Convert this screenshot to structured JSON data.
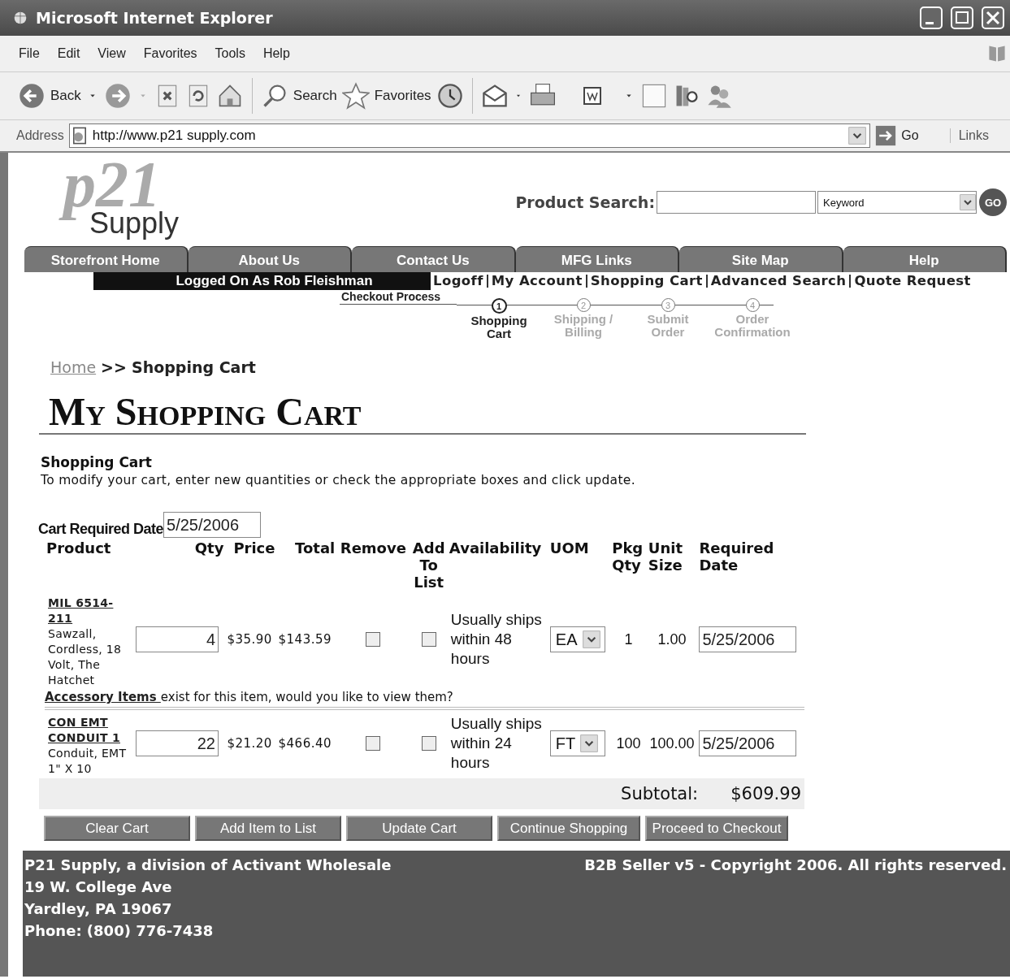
{
  "window": {
    "title": "Microsoft Internet Explorer"
  },
  "menu": [
    "File",
    "Edit",
    "View",
    "Favorites",
    "Tools",
    "Help"
  ],
  "toolbar": {
    "back": "Back",
    "search": "Search",
    "favorites": "Favorites"
  },
  "address": {
    "label": "Address",
    "url": "http://www.p21 supply.com",
    "go": "Go",
    "links": "Links"
  },
  "header": {
    "logo_mark": "p21",
    "logo_word": "Supply",
    "search_label": "Product Search:",
    "search_type": "Keyword",
    "go": "GO"
  },
  "nav_tabs": [
    "Storefront Home",
    "About Us",
    "Contact Us",
    "MFG Links",
    "Site Map",
    "Help"
  ],
  "logged_in": "Logged On As Rob Fleishman",
  "user_links": [
    "Logoff",
    "My Account",
    "Shopping Cart",
    "Advanced Search",
    "Quote Request"
  ],
  "checkout": {
    "label": "Checkout Process",
    "steps": [
      {
        "number": "1",
        "lines": [
          "Shopping",
          "Cart"
        ],
        "selected": true
      },
      {
        "number": "2",
        "lines": [
          "Shipping /",
          "Billing"
        ],
        "selected": false
      },
      {
        "number": "3",
        "lines": [
          "Submit",
          "Order"
        ],
        "selected": false
      },
      {
        "number": "4",
        "lines": [
          "Order",
          "Confirmation"
        ],
        "selected": false
      }
    ]
  },
  "breadcrumb": {
    "home": "Home ",
    "separator": ">>",
    "current": "Shopping Cart"
  },
  "page_title": "My Shopping Cart",
  "section": {
    "heading": "Shopping Cart",
    "instructions": "To modify your cart, enter new quantities or check the appropriate boxes and click update."
  },
  "cart_required_date": {
    "label": "Cart Required Date",
    "value": "5/25/2006"
  },
  "table": {
    "columns": [
      [
        "Product"
      ],
      [
        "Qty"
      ],
      [
        "Price"
      ],
      [
        "Total"
      ],
      [
        "Remove"
      ],
      [
        "Add",
        "To",
        "List"
      ],
      [
        "Availability"
      ],
      [
        "UOM"
      ],
      [
        "Pkg",
        "Qty"
      ],
      [
        "Unit",
        "Size"
      ],
      [
        "Required",
        "Date"
      ]
    ],
    "rows": [
      {
        "code": "MIL 6514-211",
        "description": "Sawzall, Cordless, 18 Volt, The Hatchet",
        "qty": "4",
        "price": "$35.90",
        "total": "$143.59",
        "remove": false,
        "add_to_list": false,
        "availability": "Usually ships within 48 hours",
        "uom": "EA",
        "pkg_qty": "1",
        "unit_size": "1.00",
        "required_date": "5/25/2006",
        "accessory": {
          "link": "Accessory Items ",
          "text": "exist for this item, would you like to view them?"
        }
      },
      {
        "code": "CON EMT CONDUIT 1",
        "description": "Conduit, EMT 1\" X 10",
        "qty": "22",
        "price": "$21.20",
        "total": "$466.40",
        "remove": false,
        "add_to_list": false,
        "availability": "Usually ships within 24 hours",
        "uom": "FT",
        "pkg_qty": "100",
        "unit_size": "100.00",
        "required_date": "5/25/2006"
      }
    ],
    "subtotal_label": "Subtotal:",
    "subtotal_value": "$609.99"
  },
  "buttons": [
    "Clear Cart",
    "Add Item to List",
    "Update  Cart",
    "Continue Shopping",
    "Proceed to Checkout"
  ],
  "footer": {
    "address_lines": [
      "P21 Supply, a division of Activant Wholesale",
      "19 W. College Ave",
      "Yardley, PA 19067",
      "Phone: (800) 776-7438"
    ],
    "copyright": "B2B Seller v5 - Copyright 2006. All rights reserved."
  }
}
